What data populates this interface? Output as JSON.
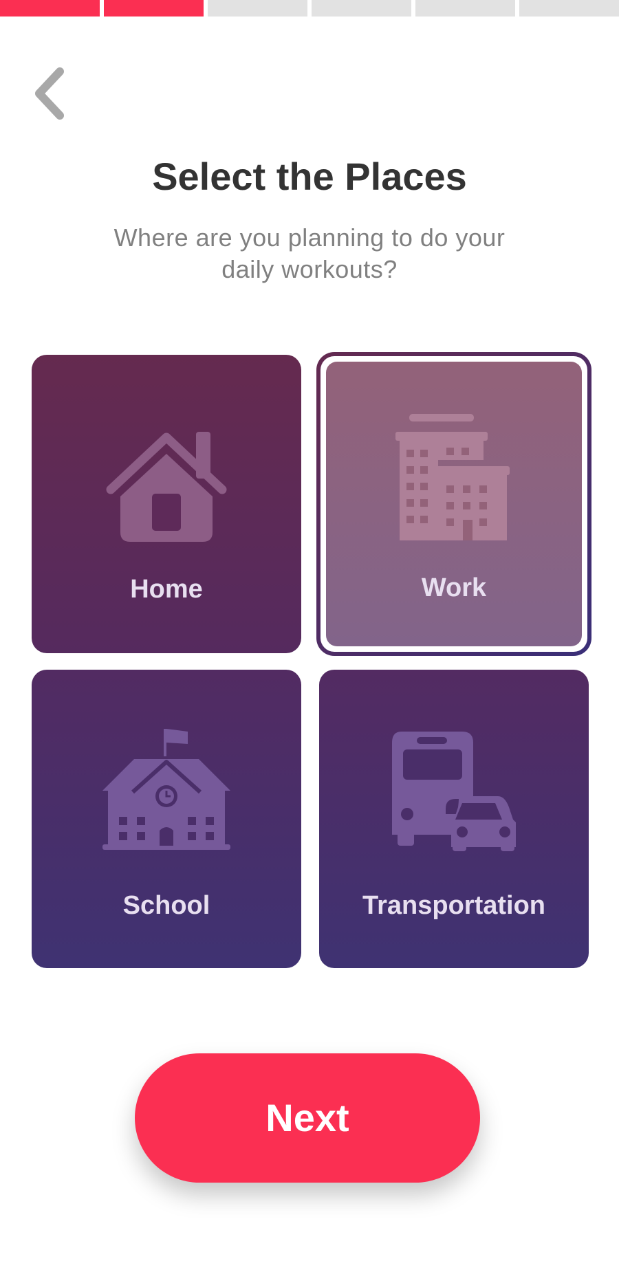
{
  "progress": {
    "total_steps": 6,
    "completed_steps": 2,
    "active_color": "#fb2f52",
    "inactive_color": "#e2e2e2"
  },
  "header": {
    "back_icon": "chevron-left-icon",
    "title": "Select the Places",
    "subtitle": "Where are you planning to do your daily workouts?"
  },
  "places": [
    {
      "id": "home",
      "label": "Home",
      "icon": "house-icon",
      "selected": false
    },
    {
      "id": "work",
      "label": "Work",
      "icon": "office-buildings-icon",
      "selected": true
    },
    {
      "id": "school",
      "label": "School",
      "icon": "school-building-icon",
      "selected": false
    },
    {
      "id": "transportation",
      "label": "Transportation",
      "icon": "bus-and-car-icon",
      "selected": false
    }
  ],
  "footer": {
    "next_label": "Next"
  },
  "colors": {
    "accent": "#fb2f52",
    "title": "#333333",
    "subtitle": "#808080"
  }
}
